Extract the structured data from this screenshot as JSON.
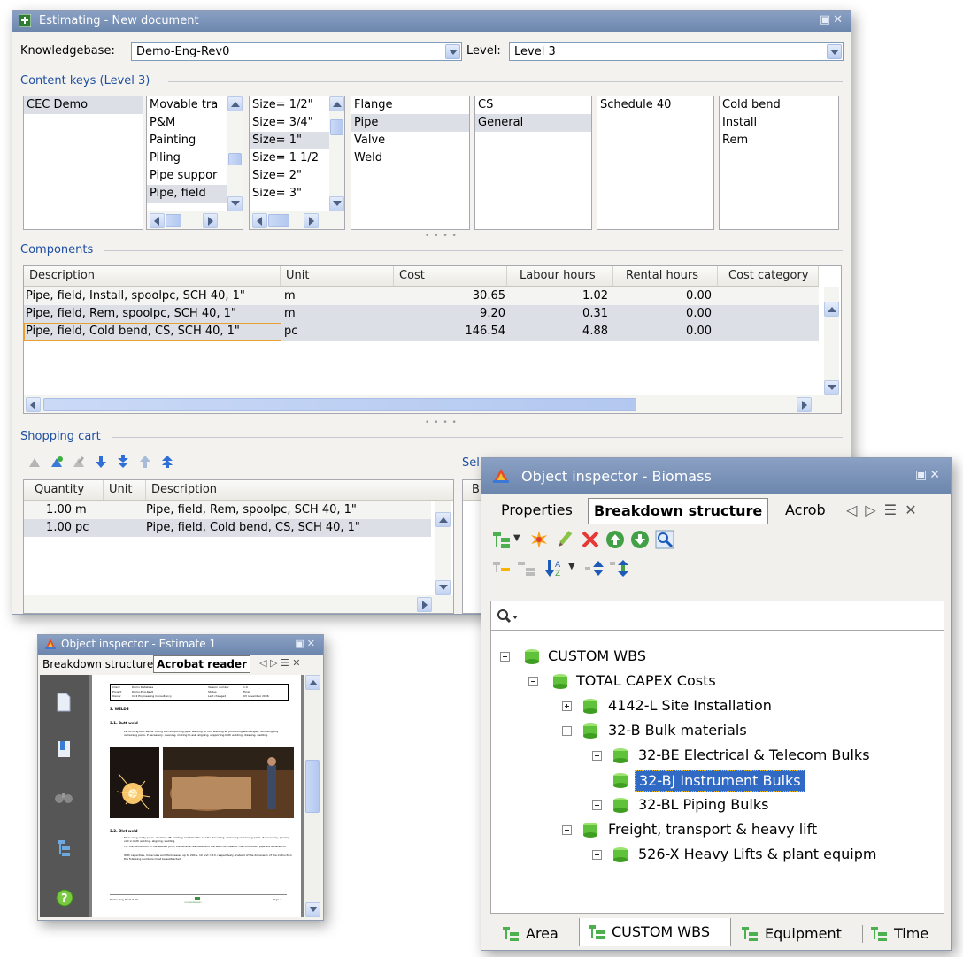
{
  "estimating": {
    "title": "Estimating - New document",
    "knowledgebase_label": "Knowledgebase:",
    "knowledgebase_value": "Demo-Eng-Rev0",
    "level_label": "Level:",
    "level_value": "Level 3",
    "content_keys_title": "Content keys  (Level 3)",
    "key_lists": [
      [
        "CEC Demo"
      ],
      [
        "Movable tra",
        "P&M",
        "Painting",
        "Piling",
        "Pipe suppor",
        "Pipe, field"
      ],
      [
        "Size= 1/2\"",
        "Size= 3/4\"",
        "Size= 1\"",
        "Size= 1 1/2",
        "Size= 2\"",
        "Size= 3\""
      ],
      [
        "Flange",
        "Pipe",
        "Valve",
        "Weld"
      ],
      [
        "CS",
        "General"
      ],
      [
        "Schedule 40"
      ],
      [
        "Cold bend",
        "Install",
        "Rem"
      ]
    ],
    "components_title": "Components",
    "components_headers": [
      "Description",
      "Unit",
      "Cost",
      "Labour hours",
      "Rental hours",
      "Cost category"
    ],
    "components_rows": [
      [
        "Pipe, field, Install, spoolpc, SCH 40, 1\"",
        "m",
        "30.65",
        "1.02",
        "0.00",
        ""
      ],
      [
        "Pipe, field, Rem, spoolpc, SCH 40, 1\"",
        "m",
        "9.20",
        "0.31",
        "0.00",
        ""
      ],
      [
        "Pipe, field, Cold bend, CS, SCH 40, 1\"",
        "pc",
        "146.54",
        "4.88",
        "0.00",
        ""
      ]
    ],
    "shopping_cart_title": "Shopping cart",
    "cart_headers": [
      "Quantity",
      "Unit",
      "Description"
    ],
    "cart_rows": [
      [
        "1.00",
        "m",
        "Pipe, field, Rem, spoolpc, SCH 40, 1\""
      ],
      [
        "1.00",
        "pc",
        "Pipe, field, Cold bend, CS, SCH 40, 1\""
      ]
    ],
    "selection_title_fragment": "Sel",
    "selection_header_fragment": "B"
  },
  "inspector_estimate": {
    "title": "Object inspector - Estimate 1",
    "tabs": [
      "Breakdown structure",
      "Acrobat reader"
    ],
    "sidebar_icons": [
      "document-icon",
      "bookmarks-icon",
      "binoculars-icon",
      "tree-icon",
      "help-icon"
    ]
  },
  "pdf": {
    "header_cells": [
      "Client",
      "Demo Database",
      "Version number",
      "1.0",
      "Project",
      "Demo-Eng-Rev0",
      "Status",
      "Final",
      "Owner",
      "Civil Engineering Consultancy",
      "Last changed",
      "03 november 2006"
    ],
    "section": "3.    WELDS",
    "subsection1": "3.1.    Butt weld",
    "para1": "Performing butt welds: fitting and supporting pipe, welding all run, welding all protruding weld edges, removing any remaining parts, if necessary, cleaning, making to ask, aligning, supporting both welding, dressing, welding.",
    "subsection2": "3.2.    Olet weld",
    "para2": "Measuring ready pipes, marking off, welding and take the needle, bevelling, removing remaining parts, if necessary, placing olet in both welding, aligning, welding.",
    "para3": "For the calculation of the welded joint, the outside diameter and the wall thickness of the continuous pipe are adhered to.",
    "para4": "With capacities, molecules and thicknesses up to 200 + 10 and = 13, respectively, instead of the dimension of the instruction the following numbers must be subtracted.",
    "footer_left": "Demo-Eng-Rev0 0.00",
    "footer_right": "Page 4",
    "footer_logo": "CIVIL ENGINEERING"
  },
  "inspector_biomass": {
    "title": "Object inspector - Biomass",
    "tabs": [
      "Properties",
      "Breakdown structure",
      "Acrob"
    ],
    "tree": [
      {
        "label": "CUSTOM WBS",
        "level": 0,
        "state": "expanded"
      },
      {
        "label": "TOTAL CAPEX Costs",
        "level": 1,
        "state": "expanded"
      },
      {
        "label": "4142-L Site Installation",
        "level": 2,
        "state": "collapsed"
      },
      {
        "label": "32-B Bulk materials",
        "level": 2,
        "state": "expanded"
      },
      {
        "label": "32-BE Electrical & Telecom Bulks",
        "level": 3,
        "state": "collapsed"
      },
      {
        "label": "32-BJ Instrument Bulks",
        "level": 3,
        "state": "leaf",
        "selected": true
      },
      {
        "label": "32-BL Piping Bulks",
        "level": 3,
        "state": "collapsed"
      },
      {
        "label": "Freight, transport & heavy lift",
        "level": 2,
        "state": "expanded"
      },
      {
        "label": "526-X Heavy Lifts & plant equipm",
        "level": 3,
        "state": "collapsed"
      }
    ],
    "bottom_tabs": [
      "Area",
      "CUSTOM WBS",
      "Equipment",
      "Time"
    ]
  },
  "colors": {
    "title_bar": "#7a91b8",
    "section_title": "#1f4fa0",
    "selection": "#316ac5",
    "tree_icon_green": "#5fc23a"
  }
}
